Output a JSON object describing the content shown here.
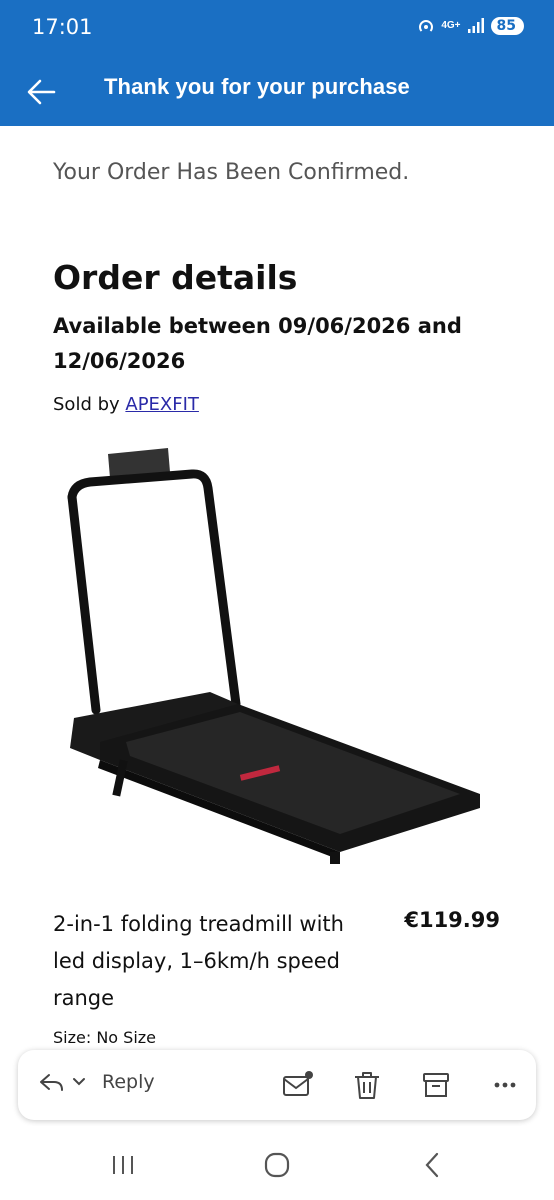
{
  "status_bar": {
    "time": "17:01",
    "network": "4G+",
    "battery": "85"
  },
  "app_bar": {
    "title": "Thank you for your purchase",
    "back_icon": "arrow-left-icon"
  },
  "order": {
    "confirmation": "Your Order Has Been Confirmed.",
    "details_heading": "Order details",
    "availability": "Available between 09/06/2026 and 12/06/2026",
    "sold_by_prefix": "Sold by ",
    "seller": "APEXFIT",
    "product_name": "2-in-1 folding treadmill with led display, 1–6km/h speed range",
    "price": "€119.99",
    "size": "Size: No Size"
  },
  "actions": {
    "reply_label": "Reply",
    "icons": [
      "reply-icon",
      "chevron-down-icon",
      "mark-unread-icon",
      "delete-icon",
      "archive-icon",
      "more-icon"
    ]
  },
  "colors": {
    "accent": "#1a6fc3",
    "link": "#2a2aa8"
  }
}
